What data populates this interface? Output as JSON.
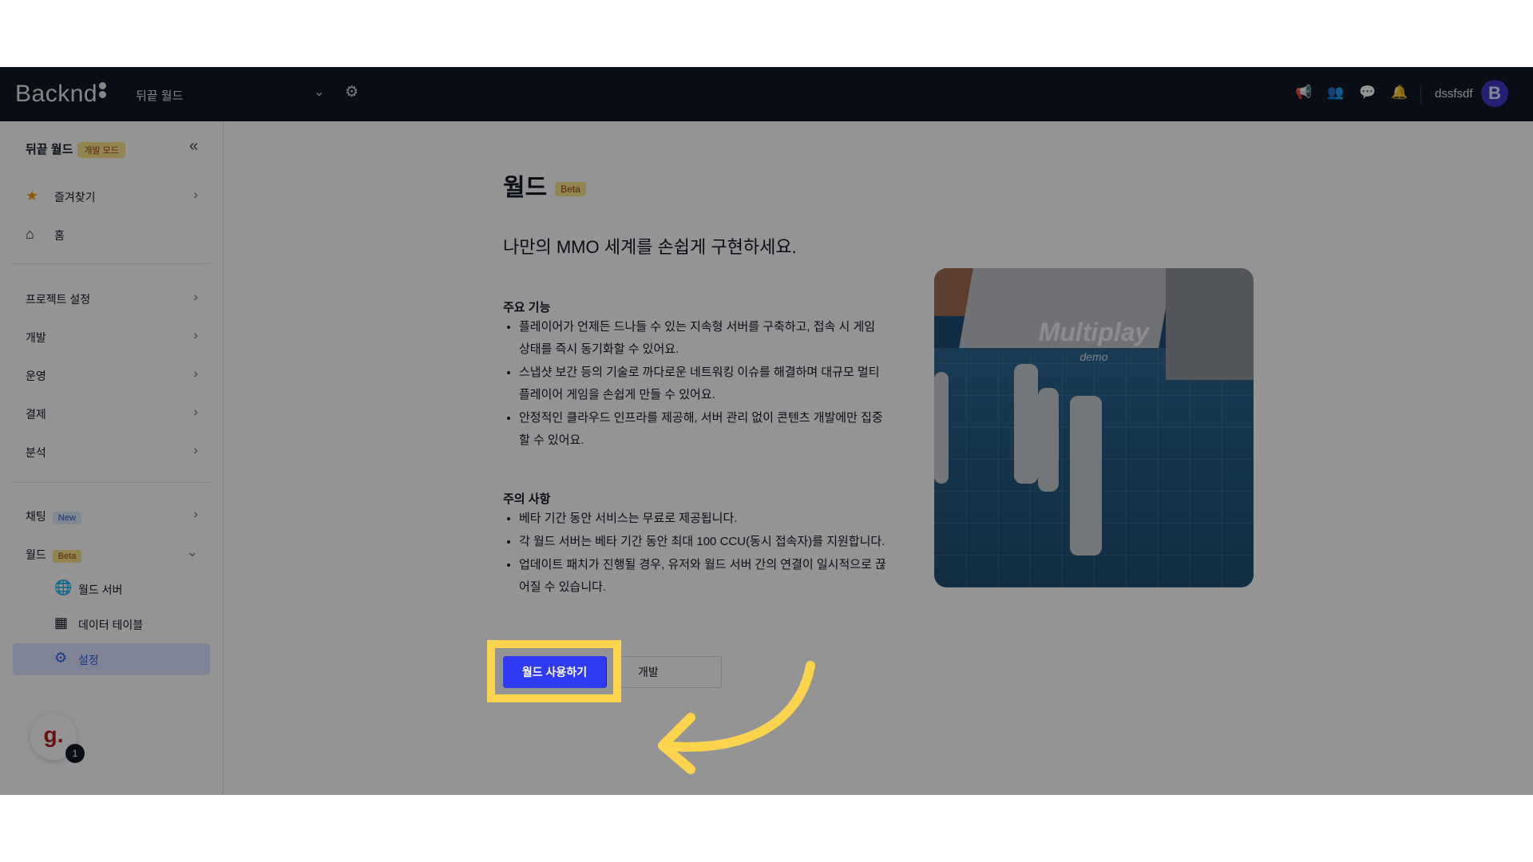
{
  "topbar": {
    "logo": "Backnd",
    "project": "뒤끝 월드",
    "icons": [
      "megaphone-icon",
      "users-icon",
      "chat-icon",
      "bell-icon"
    ],
    "user": "dssfsdf",
    "avatar": "B"
  },
  "sidebar": {
    "header": "뒤끝 월드",
    "mode_badge": "개발 모드",
    "favorites": "즐겨찾기",
    "home": "홈",
    "project_settings": "프로젝트 설정",
    "dev": "개발",
    "ops": "운영",
    "payment": "결제",
    "analytics": "분석",
    "chat": "채팅",
    "chat_badge": "New",
    "world": "월드",
    "world_badge": "Beta",
    "world_server": "월드 서버",
    "data_table": "데이터 테이블",
    "settings": "설정",
    "fab": "g.",
    "fab_count": "1"
  },
  "main": {
    "title": "월드",
    "title_badge": "Beta",
    "subtitle": "나만의 MMO 세계를 손쉽게 구현하세요.",
    "features_title": "주요 기능",
    "features": [
      "플레이어가 언제든 드나들 수 있는 지속형 서버를 구축하고, 접속 시 게임 상태를 즉시 동기화할 수 있어요.",
      "스냅샷 보간 등의 기술로 까다로운 네트워킹 이슈를 해결하며 대규모 멀티 플레이어 게임을 손쉽게 만들 수 있어요.",
      "안정적인 클라우드 인프라를 제공해, 서버 관리 없이 콘텐츠 개발에만 집중할 수 있어요."
    ],
    "notes_title": "주의 사항",
    "notes": [
      "베타 기간 동안 서비스는 무료로 제공됩니다.",
      "각 월드 서버는 베타 기간 동안 최대 100 CCU(동시 접속자)를 지원합니다.",
      "업데이트 패치가 진행될 경우, 유저와 월드 서버 간의 연결이 일시적으로 끊어질 수 있습니다."
    ],
    "primary_button": "월드 사용하기",
    "secondary_button": "개발",
    "hero_title": "Multiplay",
    "hero_sub": "demo"
  },
  "colors": {
    "topbar": "#111827",
    "primary": "#2f3bf0",
    "highlight": "#fcd34d"
  }
}
